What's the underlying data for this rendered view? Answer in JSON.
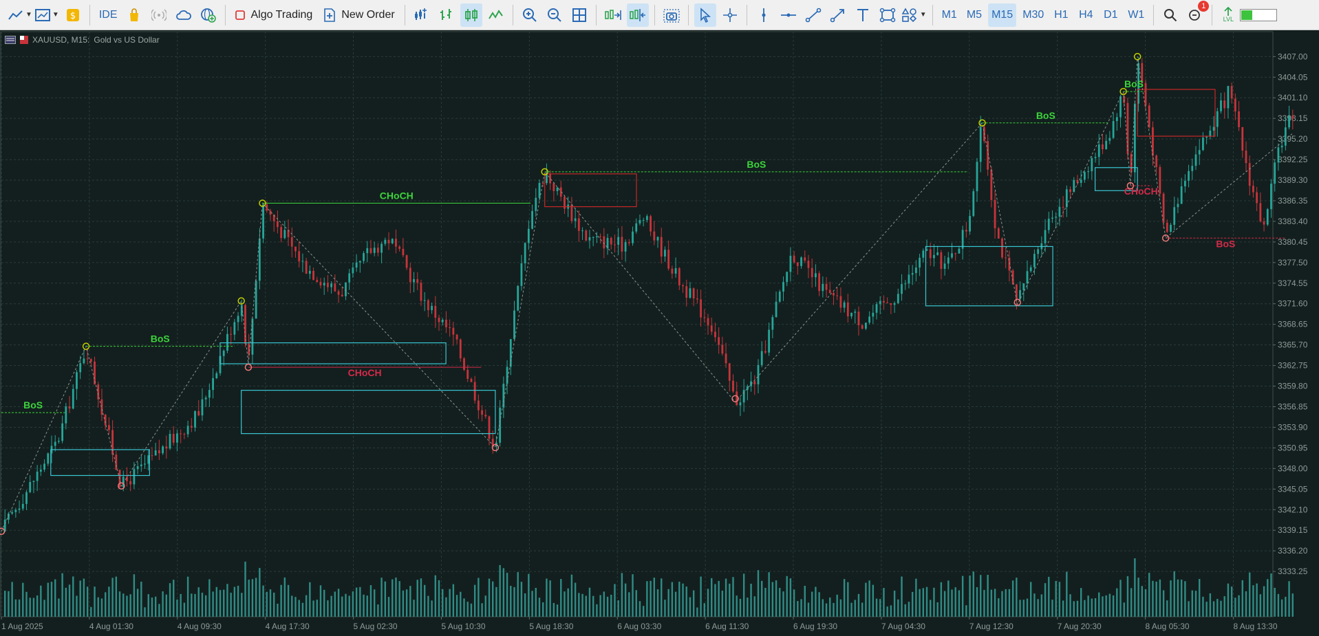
{
  "toolbar": {
    "ide_label": "IDE",
    "algo_trading_label": "Algo Trading",
    "new_order_label": "New Order",
    "timeframes": [
      {
        "label": "M1",
        "active": false
      },
      {
        "label": "M5",
        "active": false
      },
      {
        "label": "M15",
        "active": true
      },
      {
        "label": "M30",
        "active": false
      },
      {
        "label": "H1",
        "active": false
      },
      {
        "label": "H4",
        "active": false
      },
      {
        "label": "D1",
        "active": false
      },
      {
        "label": "W1",
        "active": false
      }
    ],
    "notification_count": "1",
    "level_label": "LVL",
    "level_value": 0.3
  },
  "legend": {
    "symbol": "XAUUSD, M15:",
    "description": "Gold vs US Dollar"
  },
  "chart_data": {
    "type": "candlestick",
    "symbol": "XAUUSD",
    "timeframe": "M15",
    "ylim": [
      3330.9,
      3409.0
    ],
    "y_ticks": [
      "3407.00",
      "3404.05",
      "3401.10",
      "3398.15",
      "3395.20",
      "3392.25",
      "3389.30",
      "3386.35",
      "3383.40",
      "3380.45",
      "3377.50",
      "3374.55",
      "3371.60",
      "3368.65",
      "3365.70",
      "3362.75",
      "3359.80",
      "3356.85",
      "3353.90",
      "3350.95",
      "3348.00",
      "3345.05",
      "3342.10",
      "3339.15",
      "3336.20",
      "3333.25"
    ],
    "x_ticks": [
      "1 Aug 2025",
      "4 Aug 01:30",
      "4 Aug 09:30",
      "4 Aug 17:30",
      "5 Aug 02:30",
      "5 Aug 10:30",
      "5 Aug 18:30",
      "6 Aug 03:30",
      "6 Aug 11:30",
      "6 Aug 19:30",
      "7 Aug 04:30",
      "7 Aug 12:30",
      "7 Aug 20:30",
      "8 Aug 05:30",
      "8 Aug 13:30"
    ],
    "x_index_range": [
      0,
      180
    ],
    "bars": 360,
    "path": [
      [
        0,
        3339.0
      ],
      [
        8,
        3352.0
      ],
      [
        12,
        3365.5
      ],
      [
        17,
        3345.5
      ],
      [
        22,
        3350.0
      ],
      [
        28,
        3356.0
      ],
      [
        34,
        3372.0
      ],
      [
        35,
        3363.0
      ],
      [
        37,
        3386.0
      ],
      [
        43,
        3377.0
      ],
      [
        48,
        3373.0
      ],
      [
        52,
        3379.0
      ],
      [
        55,
        3381.0
      ],
      [
        60,
        3372.0
      ],
      [
        64,
        3367.0
      ],
      [
        67,
        3359.0
      ],
      [
        70,
        3351.0
      ],
      [
        72,
        3366.0
      ],
      [
        75,
        3385.0
      ],
      [
        77,
        3390.5
      ],
      [
        83,
        3381.0
      ],
      [
        88,
        3380.0
      ],
      [
        91,
        3384.0
      ],
      [
        96,
        3375.0
      ],
      [
        101,
        3368.0
      ],
      [
        104,
        3357.5
      ],
      [
        107,
        3361.0
      ],
      [
        112,
        3379.0
      ],
      [
        117,
        3373.0
      ],
      [
        122,
        3369.0
      ],
      [
        127,
        3373.0
      ],
      [
        131,
        3379.0
      ],
      [
        134,
        3377.0
      ],
      [
        137,
        3383.0
      ],
      [
        139,
        3397.5
      ],
      [
        141,
        3382.0
      ],
      [
        144,
        3371.5
      ],
      [
        148,
        3383.0
      ],
      [
        153,
        3390.0
      ],
      [
        157,
        3396.0
      ],
      [
        159,
        3402.0
      ],
      [
        160,
        3388.5
      ],
      [
        161,
        3407.0
      ],
      [
        163,
        3395.0
      ],
      [
        165,
        3381.0
      ],
      [
        168,
        3391.0
      ],
      [
        171,
        3396.0
      ],
      [
        174,
        3402.0
      ],
      [
        177,
        3389.0
      ],
      [
        179,
        3382.0
      ],
      [
        181,
        3394.0
      ],
      [
        183,
        3399.0
      ]
    ],
    "zigzag": [
      [
        0,
        3339.0
      ],
      [
        12,
        3365.5
      ],
      [
        17,
        3345.5
      ],
      [
        34,
        3372.0
      ],
      [
        35,
        3363.0
      ],
      [
        37,
        3386.0
      ],
      [
        70,
        3351.0
      ],
      [
        77,
        3390.5
      ],
      [
        104,
        3357.5
      ],
      [
        139,
        3397.5
      ],
      [
        144,
        3371.5
      ],
      [
        159,
        3402.0
      ],
      [
        160,
        3388.5
      ],
      [
        161,
        3407.0
      ],
      [
        165,
        3381.0
      ],
      [
        183,
        3396.0
      ]
    ],
    "swing_markers": [
      {
        "x": 0,
        "y": 3339.0,
        "kind": "low"
      },
      {
        "x": 12,
        "y": 3365.5,
        "kind": "high"
      },
      {
        "x": 17,
        "y": 3345.5,
        "kind": "low"
      },
      {
        "x": 34,
        "y": 3372.0,
        "kind": "high"
      },
      {
        "x": 35,
        "y": 3362.5,
        "kind": "low"
      },
      {
        "x": 37,
        "y": 3386.0,
        "kind": "high"
      },
      {
        "x": 70,
        "y": 3351.0,
        "kind": "low"
      },
      {
        "x": 77,
        "y": 3390.5,
        "kind": "high"
      },
      {
        "x": 104,
        "y": 3358.0,
        "kind": "low"
      },
      {
        "x": 139,
        "y": 3397.5,
        "kind": "high"
      },
      {
        "x": 144,
        "y": 3371.8,
        "kind": "low"
      },
      {
        "x": 159,
        "y": 3402.0,
        "kind": "high"
      },
      {
        "x": 160,
        "y": 3388.5,
        "kind": "low"
      },
      {
        "x": 161,
        "y": 3407.0,
        "kind": "high"
      },
      {
        "x": 165,
        "y": 3381.0,
        "kind": "low"
      }
    ],
    "structure_lines": [
      {
        "x1": 0,
        "x2": 9,
        "y": 3356.0,
        "color": "#3cd43c",
        "dashed": true,
        "label": "BoS"
      },
      {
        "x1": 12,
        "x2": 33,
        "y": 3365.5,
        "color": "#3cd43c",
        "dashed": true,
        "label": "BoS"
      },
      {
        "x1": 37,
        "x2": 75,
        "y": 3386.0,
        "color": "#3cd43c",
        "dashed": false,
        "label": "CHoCH"
      },
      {
        "x1": 35,
        "x2": 68,
        "y": 3362.5,
        "color": "#d42a4a",
        "dashed": false,
        "label": "CHoCH"
      },
      {
        "x1": 77,
        "x2": 137,
        "y": 3390.5,
        "color": "#3cd43c",
        "dashed": true,
        "label": "BoS"
      },
      {
        "x1": 139,
        "x2": 157,
        "y": 3397.5,
        "color": "#3cd43c",
        "dashed": true,
        "label": "BoS"
      },
      {
        "x1": 159,
        "x2": 162,
        "y": 3402.0,
        "color": "#3cd43c",
        "dashed": true,
        "label": "BoS"
      },
      {
        "x1": 160,
        "x2": 163,
        "y": 3388.5,
        "color": "#d42a4a",
        "dashed": true,
        "label": "CHoCH"
      },
      {
        "x1": 165,
        "x2": 182,
        "y": 3381.0,
        "color": "#d42a4a",
        "dashed": true,
        "label": "BoS"
      }
    ],
    "zones": [
      {
        "x1": 7,
        "x2": 21,
        "y1": 3347.0,
        "y2": 3350.7,
        "color": "#39c6d4"
      },
      {
        "x1": 31,
        "x2": 63,
        "y1": 3363.0,
        "y2": 3366.0,
        "color": "#39c6d4"
      },
      {
        "x1": 34,
        "x2": 70,
        "y1": 3353.0,
        "y2": 3359.2,
        "color": "#39c6d4"
      },
      {
        "x1": 77,
        "x2": 90,
        "y1": 3385.5,
        "y2": 3390.2,
        "color": "#c62828"
      },
      {
        "x1": 131,
        "x2": 149,
        "y1": 3371.3,
        "y2": 3379.8,
        "color": "#39c6d4"
      },
      {
        "x1": 155,
        "x2": 161,
        "y1": 3387.8,
        "y2": 3391.1,
        "color": "#39c6d4"
      },
      {
        "x1": 161,
        "x2": 172,
        "y1": 3395.6,
        "y2": 3402.3,
        "color": "#c62828"
      }
    ],
    "colors": {
      "background": "#131f1e",
      "grid": "#2a3b39",
      "bull": "#26a69a",
      "bear": "#c8343b",
      "volume": "#2f8c86",
      "axis_text": "#8c9a98",
      "zigzag": "#8b9694",
      "high_marker": "#c4d200",
      "low_marker": "#f07a7a"
    }
  }
}
